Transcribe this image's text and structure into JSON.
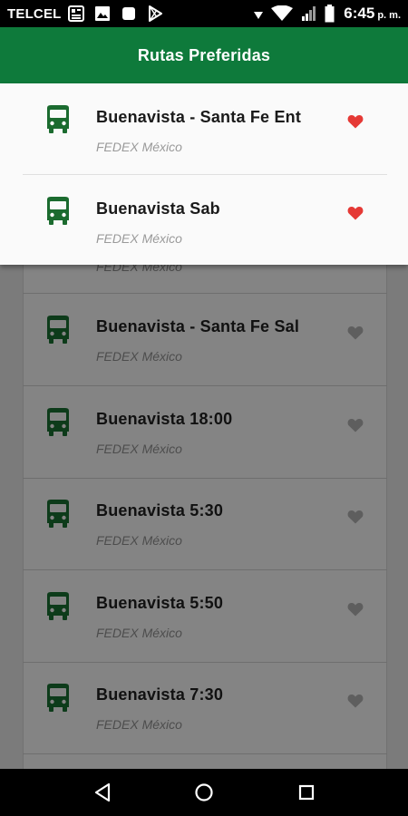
{
  "status_bar": {
    "carrier": "TELCEL",
    "time": "6:45",
    "ampm": "p. m.",
    "icons": [
      "news-icon",
      "image-icon",
      "square-icon",
      "play-store-icon",
      "alarm-icon",
      "wifi-icon",
      "signal-icon",
      "battery-icon"
    ]
  },
  "dialog": {
    "title": "Rutas Preferidas",
    "items": [
      {
        "title": "Buenavista - Santa Fe Ent",
        "subtitle": "FEDEX México",
        "favorite": true
      },
      {
        "title": "Buenavista Sab",
        "subtitle": "FEDEX México",
        "favorite": true
      }
    ]
  },
  "background_list": {
    "partial_subtitle": "FEDEX México",
    "items": [
      {
        "title": "Buenavista - Santa Fe Sal",
        "subtitle": "FEDEX México",
        "favorite": false
      },
      {
        "title": "Buenavista 18:00",
        "subtitle": "FEDEX México",
        "favorite": false
      },
      {
        "title": "Buenavista 5:30",
        "subtitle": "FEDEX México",
        "favorite": false
      },
      {
        "title": "Buenavista 5:50",
        "subtitle": "FEDEX México",
        "favorite": false
      },
      {
        "title": "Buenavista 7:30",
        "subtitle": "FEDEX México",
        "favorite": false
      }
    ]
  },
  "nav_bar": {
    "buttons": [
      "back-icon",
      "home-icon",
      "recents-icon"
    ]
  },
  "colors": {
    "brand_green": "#0e7a3b",
    "bus_icon_green": "#1b6b2f",
    "heart_red": "#e53935",
    "heart_inactive": "#5e5e5e"
  }
}
